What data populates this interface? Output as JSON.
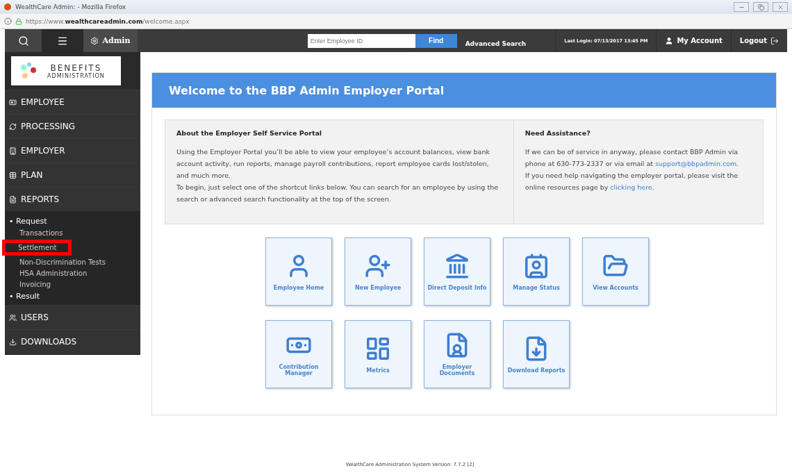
{
  "browser": {
    "title": "WealthCare Admin: - Mozilla Firefox",
    "url_prefix": "https://www.",
    "url_domain": "wealthcareadmin.com",
    "url_path": "/welcome.aspx"
  },
  "nav": {
    "admin": "Admin",
    "search_placeholder": "Enter Employee ID",
    "find": "Find",
    "advanced_search": "Advanced Search",
    "last_login": "Last Login: 07/13/2017 13:45 PM",
    "my_account": "My Account",
    "logout": "Logout"
  },
  "logo": {
    "line1": "BENEFITS",
    "line2": "ADMINISTRATION"
  },
  "sidebar": [
    {
      "label": "EMPLOYEE"
    },
    {
      "label": "PROCESSING"
    },
    {
      "label": "EMPLOYER"
    },
    {
      "label": "PLAN"
    },
    {
      "label": "REPORTS",
      "groups": [
        {
          "label": "• Request",
          "items": [
            {
              "label": "Transactions",
              "highlighted": false
            },
            {
              "label": "Settlement",
              "highlighted": true
            },
            {
              "label": "Non-Discrimination Tests",
              "highlighted": false
            },
            {
              "label": "HSA Administration",
              "highlighted": false
            },
            {
              "label": "Invoicing",
              "highlighted": false
            }
          ]
        },
        {
          "label": "• Result"
        }
      ]
    },
    {
      "label": "USERS"
    },
    {
      "label": "DOWNLOADS"
    }
  ],
  "banner": "Welcome to the BBP Admin Employer Portal",
  "about": {
    "title": "About the Employer Self Service Portal",
    "paragraphs": [
      "Using the Employer Portal you’ll be able to view your employee’s account balances, view bank account activity, run reports, manage payroll contributions, report employee cards lost/stolen, and much more.",
      "To begin, just select one of the shortcut links below. You can search for an employee by using the search or advanced search functionality at the top of the screen."
    ]
  },
  "assistance": {
    "title": "Need Assistance?",
    "line1": "If we can be of service in anyway, please contact BBP Admin via phone at 630-773-2337 or via email at",
    "email": "support@bbpadmin.com",
    "line1_end": ".",
    "line2": "If you need help navigating the employer portal, please visit the online resources page by",
    "link": "clicking here",
    "line2_end": "."
  },
  "tiles": [
    {
      "label": "Employee Home"
    },
    {
      "label": "New Employee"
    },
    {
      "label": "Direct Deposit Info"
    },
    {
      "label": "Manage Status"
    },
    {
      "label": "View Accounts"
    },
    {
      "label": "Contribution Manager"
    },
    {
      "label": "Metrics"
    },
    {
      "label": "Employer Documents"
    },
    {
      "label": "Download Reports"
    }
  ],
  "footer": "WealthCare Administration System  Version: 7.7.2 [2]"
}
